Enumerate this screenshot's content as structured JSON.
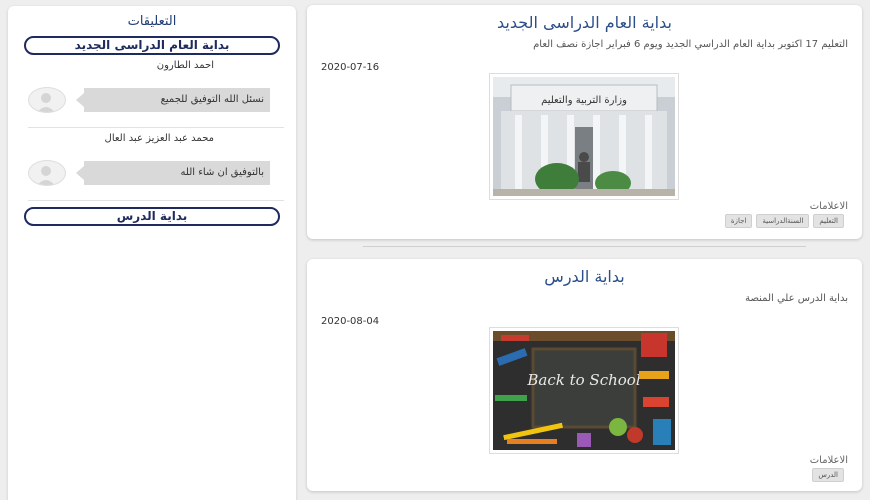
{
  "sidebar": {
    "title": "التعليقات",
    "posts": [
      {
        "title": "بداية العام الدراسى الجديد",
        "comments": [
          {
            "author": "احمد الطارون",
            "text": "نسئل الله التوفيق للجميع"
          },
          {
            "author": "محمد عبد العزيز عبد العال",
            "text": "بالتوفيق ان شاء الله"
          }
        ]
      },
      {
        "title": "بداية الدرس",
        "comments": []
      }
    ]
  },
  "posts": [
    {
      "title": "بداية العام الدراسى الجديد",
      "description": "التعليم 17 اكتوبر بداية العام الدراسي الجديد ويوم 6 فبراير اجازة نصف العام",
      "date": "2020-07-16",
      "image_alt": "وزارة التربية والتعليم",
      "category": "الاعلامات",
      "tags": [
        "التعليم",
        "السنةالدراسية",
        "اجازة"
      ]
    },
    {
      "title": "بداية الدرس",
      "description": "بداية الدرس علي المنصة",
      "date": "2020-08-04",
      "image_alt": "Back to School",
      "category": "الاعلامات",
      "tags": [
        "الدرس"
      ]
    }
  ],
  "colors": {
    "accent": "#2b4f8a",
    "pill_border": "#1f2a5e",
    "background": "#eeeeee"
  },
  "icons": {
    "avatar": "user-avatar-icon"
  }
}
